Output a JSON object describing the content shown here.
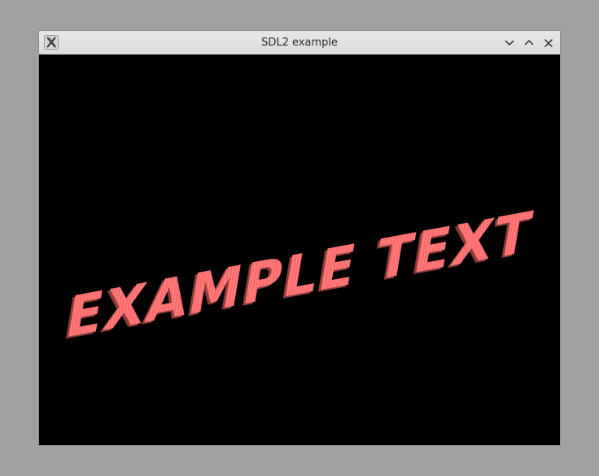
{
  "window": {
    "title": "SDL2 example",
    "controls": {
      "minimize": "chevron-down",
      "maximize": "chevron-up",
      "close": "x"
    }
  },
  "canvas": {
    "text": "EXAMPLE TEXT",
    "text_color": "#ff6b6b",
    "background": "#000000"
  }
}
